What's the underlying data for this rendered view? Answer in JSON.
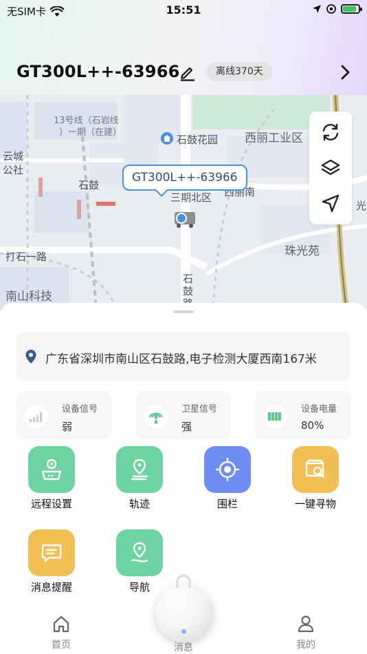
{
  "status_bar": {
    "carrier": "无SIM卡",
    "time": "15:51"
  },
  "device": {
    "name": "GT300L++-63966",
    "offline_badge": "离线370天"
  },
  "map": {
    "labels": {
      "line13": "13号线（石岩线",
      "line13b": "）一期（在建）",
      "park": "石鼓花园",
      "industrial": "西丽工业区",
      "cloud_city": "云城",
      "office": "公社",
      "shigu": "石鼓",
      "phase3": "三期北区",
      "xilinan": "西丽南",
      "zhuguangyuan": "珠光苑",
      "dashi1": "打石一路",
      "nanshan_tech": "南山科技",
      "shigu_road": "石鼓路",
      "guang": "光"
    },
    "marker_callout": "GT300L++-63966"
  },
  "address": "广东省深圳市南山区石鼓路,电子检测大厦西南167米",
  "stats": [
    {
      "label": "设备信号",
      "value": "弱",
      "icon": "signal-bars-icon"
    },
    {
      "label": "卫星信号",
      "value": "强",
      "icon": "satellite-icon"
    },
    {
      "label": "设备电量",
      "value": "80%",
      "icon": "battery-icon"
    }
  ],
  "features": [
    {
      "label": "远程设置",
      "icon": "remote-settings-icon",
      "color": "#6dd3a1"
    },
    {
      "label": "轨迹",
      "icon": "track-icon",
      "color": "#6dd3a1"
    },
    {
      "label": "围栏",
      "icon": "fence-icon",
      "color": "#6f8df2"
    },
    {
      "label": "一键寻物",
      "icon": "find-item-icon",
      "color": "#f2bf55"
    },
    {
      "label": "消息提醒",
      "icon": "message-reminder-icon",
      "color": "#f2bf55"
    },
    {
      "label": "导航",
      "icon": "navigation-icon",
      "color": "#6dd3a1"
    }
  ],
  "tabs": [
    {
      "label": "首页",
      "icon": "home-icon"
    },
    {
      "label": "消息",
      "icon": "message-icon"
    },
    {
      "label": "我的",
      "icon": "profile-icon"
    }
  ],
  "colors": {
    "accent_blue": "#4a90e2",
    "green": "#6dd3a1",
    "yellow": "#f2bf55",
    "purple_blue": "#6f8df2"
  }
}
